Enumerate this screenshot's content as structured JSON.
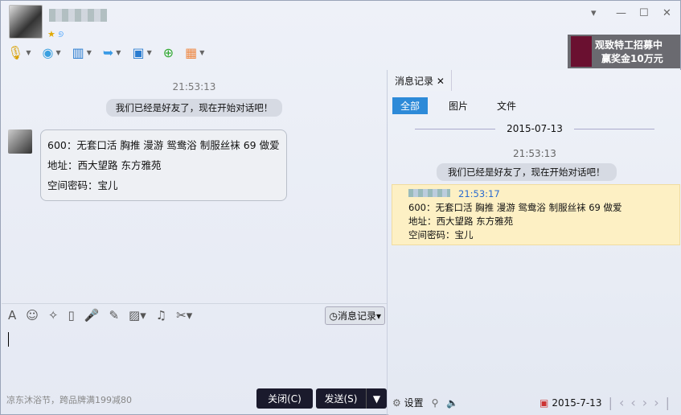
{
  "window": {
    "controls": [
      "▾",
      "—",
      "☐",
      "✕"
    ]
  },
  "header": {
    "badges": [
      "★",
      "୭"
    ]
  },
  "toolbar": [
    "voice",
    "video",
    "screen-share",
    "file-transfer",
    "remote-desktop",
    "create-discussion",
    "apps"
  ],
  "ad": {
    "line1": "观致特工招募中",
    "line2": "赢奖金10万元"
  },
  "chat": {
    "timestamp": "21:53:13",
    "system_msg": "我们已经是好友了，现在开始对话吧！",
    "message_lines": [
      "600：无套口活 胸推 漫游 鸳鸯浴 制服丝袜 69  做爱",
      "地址：西大望路 东方雅苑",
      "空间密码：宝儿"
    ]
  },
  "input": {
    "history_label": "消息记录",
    "promo": "凉东沐浴节，跨品牌满199减80",
    "close_label": "关闭(C)",
    "send_label": "发送(S)"
  },
  "history": {
    "tab": "消息记录",
    "filters": [
      "全部",
      "图片",
      "文件"
    ],
    "date": "2015-07-13",
    "timestamp": "21:53:13",
    "system_msg": "我们已经是好友了，现在开始对话吧！",
    "entry_time": "21:53:17",
    "entry_lines": [
      "600：无套口活 胸推 漫游 鸳鸯浴 制服丝袜 69  做爱",
      "地址：西大望路 东方雅苑",
      "空间密码：宝儿"
    ],
    "settings_label": "设置",
    "current_date": "2015-7-13"
  }
}
